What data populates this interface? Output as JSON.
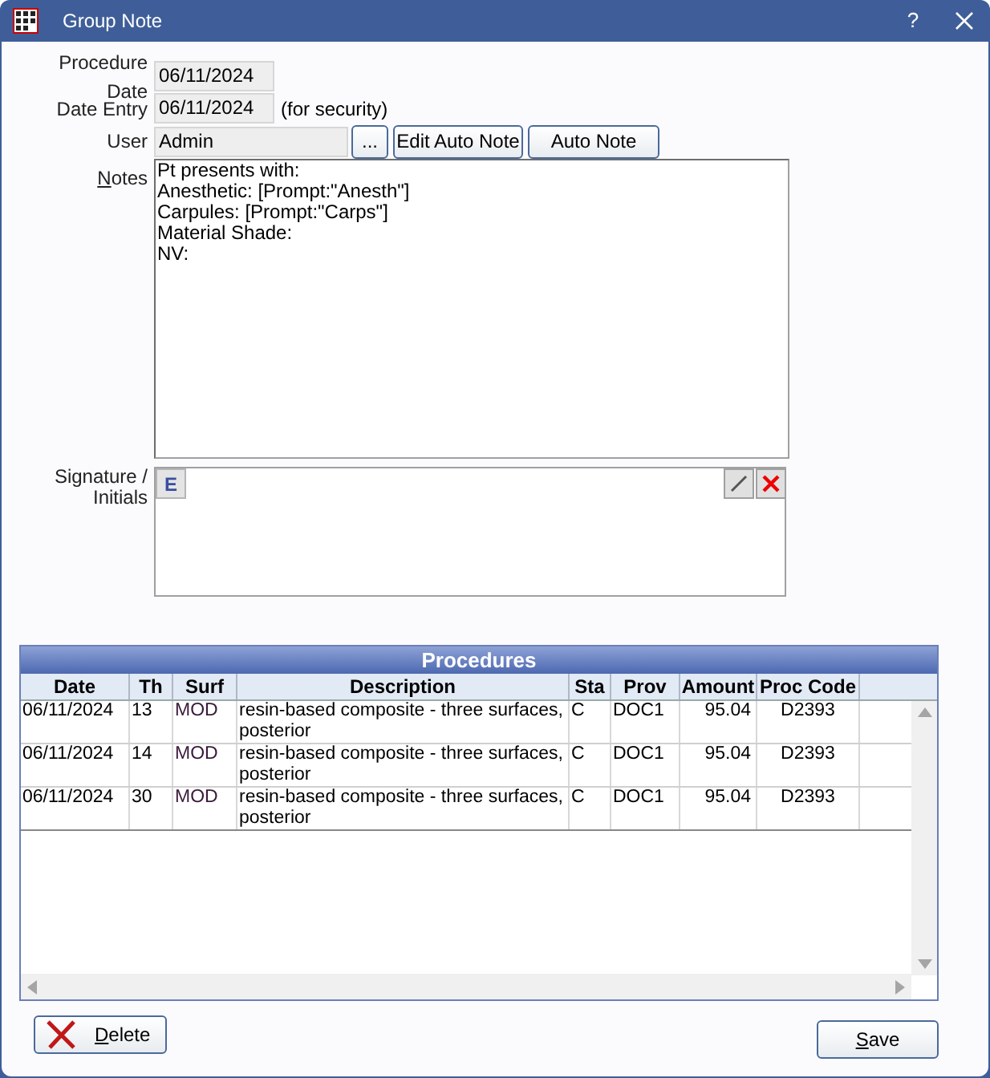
{
  "window": {
    "title": "Group Note",
    "help": "?"
  },
  "procedure_date": {
    "label": "Procedure Date",
    "value": "06/11/2024"
  },
  "date_entry": {
    "label": "Date Entry",
    "value": "06/11/2024",
    "note": "(for security)"
  },
  "user": {
    "label": "User",
    "value": "Admin"
  },
  "user_buttons": [
    "...",
    "Edit Auto Note",
    "Auto Note"
  ],
  "notes": {
    "label": "Notes",
    "value": "Pt presents with:\nAnesthetic: [Prompt:\"Anesth\"]\nCarpules: [Prompt:\"Carps\"]\nMaterial Shade:\nNV:"
  },
  "signature": {
    "label": "Signature / Initials",
    "topaz_button": "E"
  },
  "procedures": {
    "title": "Procedures",
    "columns": [
      "Date",
      "Th",
      "Surf",
      "Description",
      "Sta",
      "Prov",
      "Amount",
      "Proc Code"
    ],
    "rows": [
      {
        "cells": [
          "06/11/2024",
          "13",
          "MOD",
          "resin-based composite - three surfaces, posterior",
          "C",
          "DOC1",
          "95.04",
          "D2393"
        ]
      },
      {
        "cells": [
          "06/11/2024",
          "14",
          "MOD",
          "resin-based composite - three surfaces, posterior",
          "C",
          "DOC1",
          "95.04",
          "D2393"
        ]
      },
      {
        "cells": [
          "06/11/2024",
          "30",
          "MOD",
          "resin-based composite - three surfaces, posterior",
          "C",
          "DOC1",
          "95.04",
          "D2393"
        ]
      }
    ]
  },
  "delete_button": "Delete",
  "save_button": "Save"
}
